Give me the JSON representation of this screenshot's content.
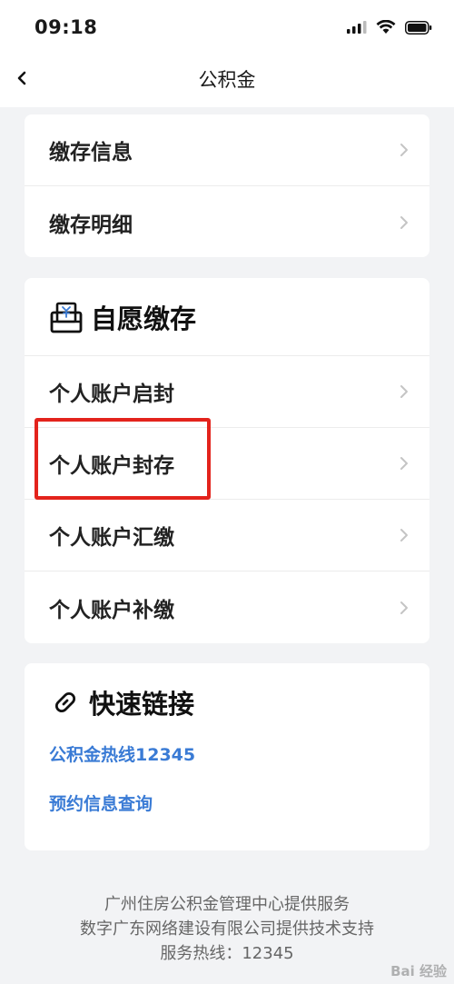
{
  "status_bar": {
    "time": "09:18"
  },
  "nav": {
    "title": "公积金"
  },
  "card1": {
    "items": [
      {
        "label": "缴存信息"
      },
      {
        "label": "缴存明细"
      }
    ]
  },
  "card2": {
    "title": "自愿缴存",
    "items": [
      {
        "label": "个人账户启封"
      },
      {
        "label": "个人账户封存"
      },
      {
        "label": "个人账户汇缴"
      },
      {
        "label": "个人账户补缴"
      }
    ]
  },
  "card3": {
    "title": "快速链接",
    "links": [
      {
        "label": "公积金热线12345"
      },
      {
        "label": "预约信息查询"
      }
    ]
  },
  "footer": {
    "line1": "广州住房公积金管理中心提供服务",
    "line2": "数字广东网络建设有限公司提供技术支持",
    "line3": "服务热线：12345"
  },
  "watermark": "Bai 经验",
  "colors": {
    "link": "#3a7bd5",
    "highlight": "#e3231c",
    "background": "#f2f3f5"
  }
}
